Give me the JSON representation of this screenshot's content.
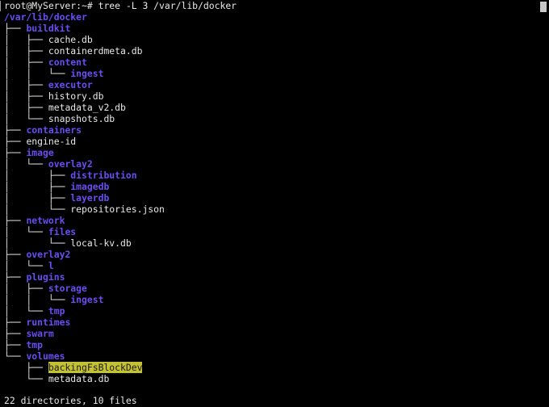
{
  "terminal": {
    "prompt": "root@MyServer:~# ",
    "command": "tree -L 3 /var/lib/docker",
    "summary": "22 directories, 10 files",
    "colors": {
      "background": "#000000",
      "text": "#e8e8e8",
      "directory": "#6c4cf3",
      "sticky_dir_bg": "#c4c232",
      "sticky_dir_fg": "#1a1a1a"
    }
  },
  "tree": [
    {
      "prefix": "",
      "name": "/var/lib/docker",
      "kind": "dir"
    },
    {
      "prefix": "├── ",
      "name": "buildkit",
      "kind": "dir"
    },
    {
      "prefix": "│   ├── ",
      "name": "cache.db",
      "kind": "file"
    },
    {
      "prefix": "│   ├── ",
      "name": "containerdmeta.db",
      "kind": "file"
    },
    {
      "prefix": "│   ├── ",
      "name": "content",
      "kind": "dir"
    },
    {
      "prefix": "│   │   └── ",
      "name": "ingest",
      "kind": "dir"
    },
    {
      "prefix": "│   ├── ",
      "name": "executor",
      "kind": "dir"
    },
    {
      "prefix": "│   ├── ",
      "name": "history.db",
      "kind": "file"
    },
    {
      "prefix": "│   ├── ",
      "name": "metadata_v2.db",
      "kind": "file"
    },
    {
      "prefix": "│   └── ",
      "name": "snapshots.db",
      "kind": "file"
    },
    {
      "prefix": "├── ",
      "name": "containers",
      "kind": "dir"
    },
    {
      "prefix": "├── ",
      "name": "engine-id",
      "kind": "file"
    },
    {
      "prefix": "├── ",
      "name": "image",
      "kind": "dir"
    },
    {
      "prefix": "│   └── ",
      "name": "overlay2",
      "kind": "dir"
    },
    {
      "prefix": "│       ├── ",
      "name": "distribution",
      "kind": "dir"
    },
    {
      "prefix": "│       ├── ",
      "name": "imagedb",
      "kind": "dir"
    },
    {
      "prefix": "│       ├── ",
      "name": "layerdb",
      "kind": "dir"
    },
    {
      "prefix": "│       └── ",
      "name": "repositories.json",
      "kind": "file"
    },
    {
      "prefix": "├── ",
      "name": "network",
      "kind": "dir"
    },
    {
      "prefix": "│   └── ",
      "name": "files",
      "kind": "dir"
    },
    {
      "prefix": "│       └── ",
      "name": "local-kv.db",
      "kind": "file"
    },
    {
      "prefix": "├── ",
      "name": "overlay2",
      "kind": "dir"
    },
    {
      "prefix": "│   └── ",
      "name": "l",
      "kind": "dir"
    },
    {
      "prefix": "├── ",
      "name": "plugins",
      "kind": "dir"
    },
    {
      "prefix": "│   ├── ",
      "name": "storage",
      "kind": "dir"
    },
    {
      "prefix": "│   │   └── ",
      "name": "ingest",
      "kind": "dir"
    },
    {
      "prefix": "│   └── ",
      "name": "tmp",
      "kind": "dir"
    },
    {
      "prefix": "├── ",
      "name": "runtimes",
      "kind": "dir"
    },
    {
      "prefix": "├── ",
      "name": "swarm",
      "kind": "dir"
    },
    {
      "prefix": "├── ",
      "name": "tmp",
      "kind": "dir"
    },
    {
      "prefix": "└── ",
      "name": "volumes",
      "kind": "dir"
    },
    {
      "prefix": "    ├── ",
      "name": "backingFsBlockDev",
      "kind": "sticky"
    },
    {
      "prefix": "    └── ",
      "name": "metadata.db",
      "kind": "file"
    }
  ]
}
